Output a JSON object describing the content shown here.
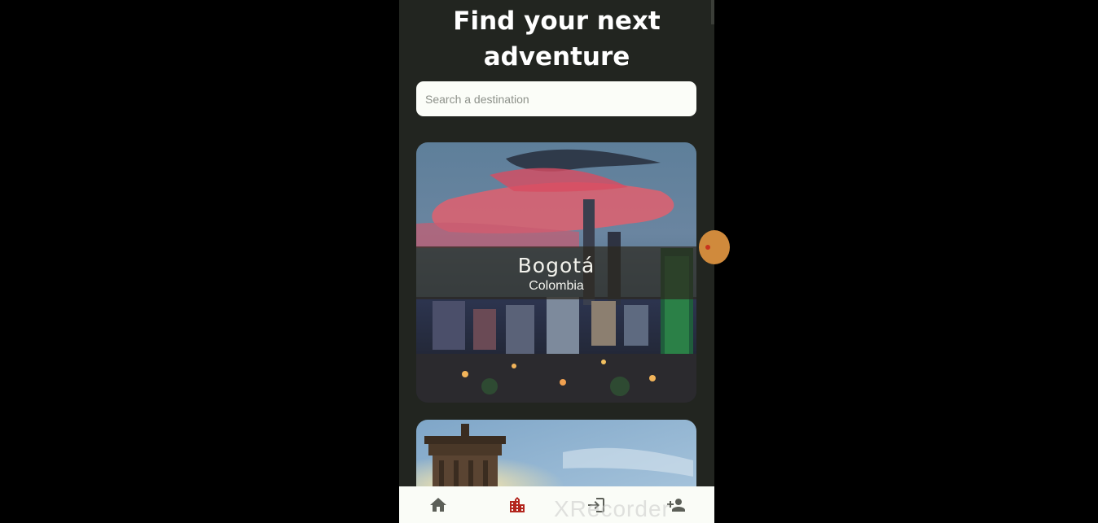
{
  "header": {
    "title_line1": "Find your next",
    "title_line2": "adventure"
  },
  "search": {
    "placeholder": "Search a destination"
  },
  "destinations": [
    {
      "city": "Bogotá",
      "country": "Colombia"
    },
    {
      "city": "",
      "country": ""
    }
  ],
  "bottom_nav": {
    "items": [
      {
        "icon": "home-icon",
        "active": false
      },
      {
        "icon": "city-icon",
        "active": true
      },
      {
        "icon": "login-icon",
        "active": false
      },
      {
        "icon": "person-add-icon",
        "active": false
      }
    ]
  },
  "colors": {
    "background": "#222520",
    "active_nav": "#b3261e",
    "inactive_nav": "#5c5f58"
  },
  "watermark": "XRecorder"
}
